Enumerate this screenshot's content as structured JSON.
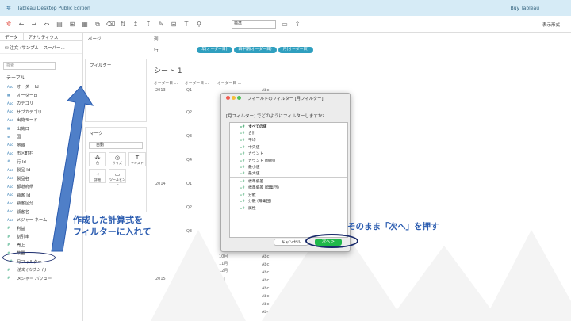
{
  "window": {
    "title": "Tableau Desktop Public Edition",
    "buy": "Buy Tableau"
  },
  "toolbar": {
    "dropdown": "標準",
    "show_me": "表示形式"
  },
  "data_pane": {
    "tabs": [
      "データ",
      "アナリティクス"
    ],
    "datasource": "注文 (サンプル - スーパー...",
    "search_placeholder": "検索",
    "table_header": "テーブル",
    "fields": [
      {
        "type": "Abc",
        "kind": "dim",
        "name": "オーダー Id"
      },
      {
        "type": "▦",
        "kind": "dim",
        "name": "オーダー日"
      },
      {
        "type": "Abc",
        "kind": "dim",
        "name": "カテゴリ"
      },
      {
        "type": "Abc",
        "kind": "dim",
        "name": "サブカテゴリ"
      },
      {
        "type": "Abc",
        "kind": "dim",
        "name": "出荷モード"
      },
      {
        "type": "▦",
        "kind": "dim",
        "name": "出荷日"
      },
      {
        "type": "⊕",
        "kind": "dim",
        "name": "国"
      },
      {
        "type": "Abc",
        "kind": "dim",
        "name": "地域"
      },
      {
        "type": "Abc",
        "kind": "dim",
        "name": "市区町村"
      },
      {
        "type": "#",
        "kind": "dim",
        "name": "行 Id"
      },
      {
        "type": "Abc",
        "kind": "dim",
        "name": "製品 Id"
      },
      {
        "type": "Abc",
        "kind": "dim",
        "name": "製品名"
      },
      {
        "type": "Abc",
        "kind": "dim",
        "name": "都道府県"
      },
      {
        "type": "Abc",
        "kind": "dim",
        "name": "顧客 Id"
      },
      {
        "type": "Abc",
        "kind": "dim",
        "name": "顧客区分"
      },
      {
        "type": "Abc",
        "kind": "dim",
        "name": "顧客名"
      },
      {
        "type": "Abc",
        "kind": "dim",
        "name": "メジャー ネーム"
      },
      {
        "type": "#",
        "kind": "meas",
        "name": "利益"
      },
      {
        "type": "#",
        "kind": "meas",
        "name": "割引率"
      },
      {
        "type": "#",
        "kind": "meas",
        "name": "売上"
      },
      {
        "type": "#",
        "kind": "meas",
        "name": "数量"
      },
      {
        "type": "=#",
        "kind": "meas",
        "name": "月フィルター"
      },
      {
        "type": "#",
        "kind": "meas",
        "name": "注文 (カウント)"
      },
      {
        "type": "#",
        "kind": "meas",
        "name": "メジャー バリュー"
      }
    ]
  },
  "cards": {
    "pages": "ページ",
    "filters": "フィルター",
    "marks": "マーク",
    "marks_type": "自動",
    "marks_buttons": [
      "色",
      "サイズ",
      "テキスト",
      "詳細",
      "ツールヒント"
    ]
  },
  "shelves": {
    "columns": "列",
    "rows": "行",
    "pills": [
      "年(オーダー日)",
      "四半期(オーダー日)",
      "月(オーダー日)"
    ]
  },
  "view": {
    "sheet_title": "シート 1",
    "headers": [
      "オーダー日 ...",
      "オーダー日 ...",
      "オーダー日 ..."
    ],
    "years": [
      "2013",
      "2014",
      "2015"
    ],
    "quarters": [
      "Q1",
      "Q2",
      "Q3",
      "Q4",
      "Q1",
      "Q2",
      "Q3",
      "Q4",
      "Q1",
      "Q2"
    ],
    "visible_months": [
      "10月",
      "11月",
      "12月",
      "1月",
      "2月",
      "3月",
      "4月",
      "5月",
      "6月"
    ],
    "abc": "Abc"
  },
  "dialog": {
    "title": "フィールドのフィルター [月フィルター]",
    "question": "[月フィルター] でどのようにフィルターしますか?",
    "options": [
      {
        "label": "すべての値",
        "bold": true
      },
      {
        "label": "合計"
      },
      {
        "label": "平均"
      },
      {
        "label": "中央値"
      },
      {
        "label": "カウント"
      },
      {
        "label": "カウント (個別)"
      },
      {
        "label": "最小値"
      },
      {
        "label": "最大値",
        "sep": true
      },
      {
        "label": "標準偏差"
      },
      {
        "label": "標準偏差 (母集団)"
      },
      {
        "label": "分散"
      },
      {
        "label": "分散 (母集団)",
        "sep": true
      },
      {
        "label": "属性"
      }
    ],
    "cancel": "キャンセル",
    "next": "次へ >"
  },
  "annotations": {
    "left": [
      "作成した計算式を",
      "フィルターに入れて"
    ],
    "right": "そのまま「次へ」を押す",
    "color": "#2b5cb0"
  }
}
